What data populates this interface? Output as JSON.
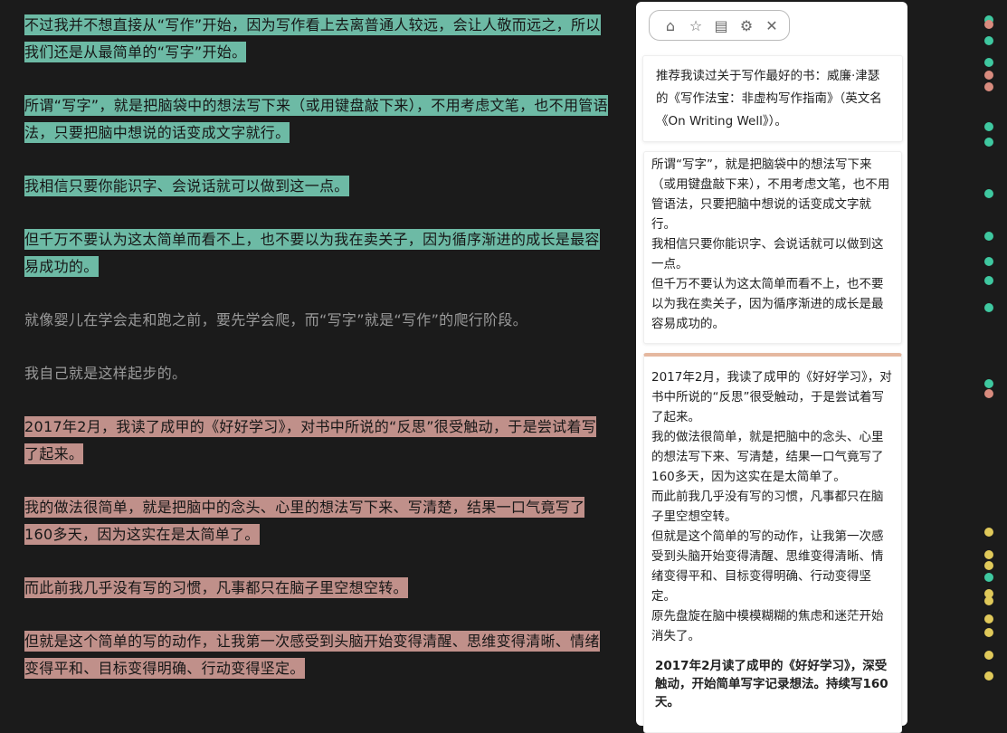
{
  "editor": {
    "paragraphs": [
      {
        "text": "不过我并不想直接从“写作”开始，因为写作看上去离普通人较远，会让人敬而远之，所以我们还是从最简单的“写字”开始。",
        "highlight": "green"
      },
      {
        "text": "所谓“写字”，就是把脑袋中的想法写下来（或用键盘敲下来），不用考虑文笔，也不用管语法，只要把脑中想说的话变成文字就行。",
        "highlight": "green"
      },
      {
        "text": "我相信只要你能识字、会说话就可以做到这一点。",
        "highlight": "green"
      },
      {
        "text": "但千万不要认为这太简单而看不上，也不要以为我在卖关子，因为循序渐进的成长是最容易成功的。",
        "highlight": "green"
      },
      {
        "text": "就像婴儿在学会走和跑之前，要先学会爬，而“写字”就是“写作”的爬行阶段。",
        "highlight": "none"
      },
      {
        "text": "我自己就是这样起步的。",
        "highlight": "none"
      },
      {
        "text": "2017年2月，我读了成甲的《好好学习》，对书中所说的“反思”很受触动，于是尝试着写了起来。",
        "highlight": "red"
      },
      {
        "text": "我的做法很简单，就是把脑中的念头、心里的想法写下来、写清楚，结果一口气竟写了160多天，因为这实在是太简单了。",
        "highlight": "red"
      },
      {
        "text": "而此前我几乎没有写的习惯，凡事都只在脑子里空想空转。",
        "highlight": "red"
      },
      {
        "text": "但就是这个简单的写的动作，让我第一次感受到头脑开始变得清醒、思维变得清晰、情绪变得平和、目标变得明确、行动变得坚定。",
        "highlight": "red"
      }
    ]
  },
  "colors": {
    "green": "#6dbaa5",
    "red": "#c0908a",
    "yellow": "#e0c95a",
    "background": "#1b1b1b"
  },
  "panel": {
    "toolbar": [
      "home-icon",
      "star-icon",
      "notes-icon",
      "gear-icon",
      "close-icon"
    ],
    "card1": "推荐我读过关于写作最好的书：威廉·津瑟的《写作法宝：非虚构写作指南》（英文名《On Writing Well》）。",
    "card2": [
      "所谓“写字”，就是把脑袋中的想法写下来（或用键盘敲下来），不用考虑文笔，也不用管语法，只要把脑中想说的话变成文字就行。",
      "我相信只要你能识字、会说话就可以做到这一点。",
      "但千万不要认为这太简单而看不上，也不要以为我在卖关子，因为循序渐进的成长是最容易成功的。"
    ],
    "card3": [
      "2017年2月，我读了成甲的《好好学习》，对书中所说的“反思”很受触动，于是尝试着写了起来。",
      "我的做法很简单，就是把脑中的念头、心里的想法写下来、写清楚，结果一口气竟写了160多天，因为这实在是太简单了。",
      "而此前我几乎没有写的习惯，凡事都只在脑子里空想空转。",
      "但就是这个简单的写的动作，让我第一次感受到头脑开始变得清醒、思维变得清晰、情绪变得平和、目标变得明确、行动变得坚定。",
      "原先盘旋在脑中模模糊糊的焦虑和迷茫开始消失了。"
    ],
    "card3_summary": "2017年2月读了成甲的《好好学习》，深受触动，开始简单写字记录想法。持续写160天。"
  }
}
